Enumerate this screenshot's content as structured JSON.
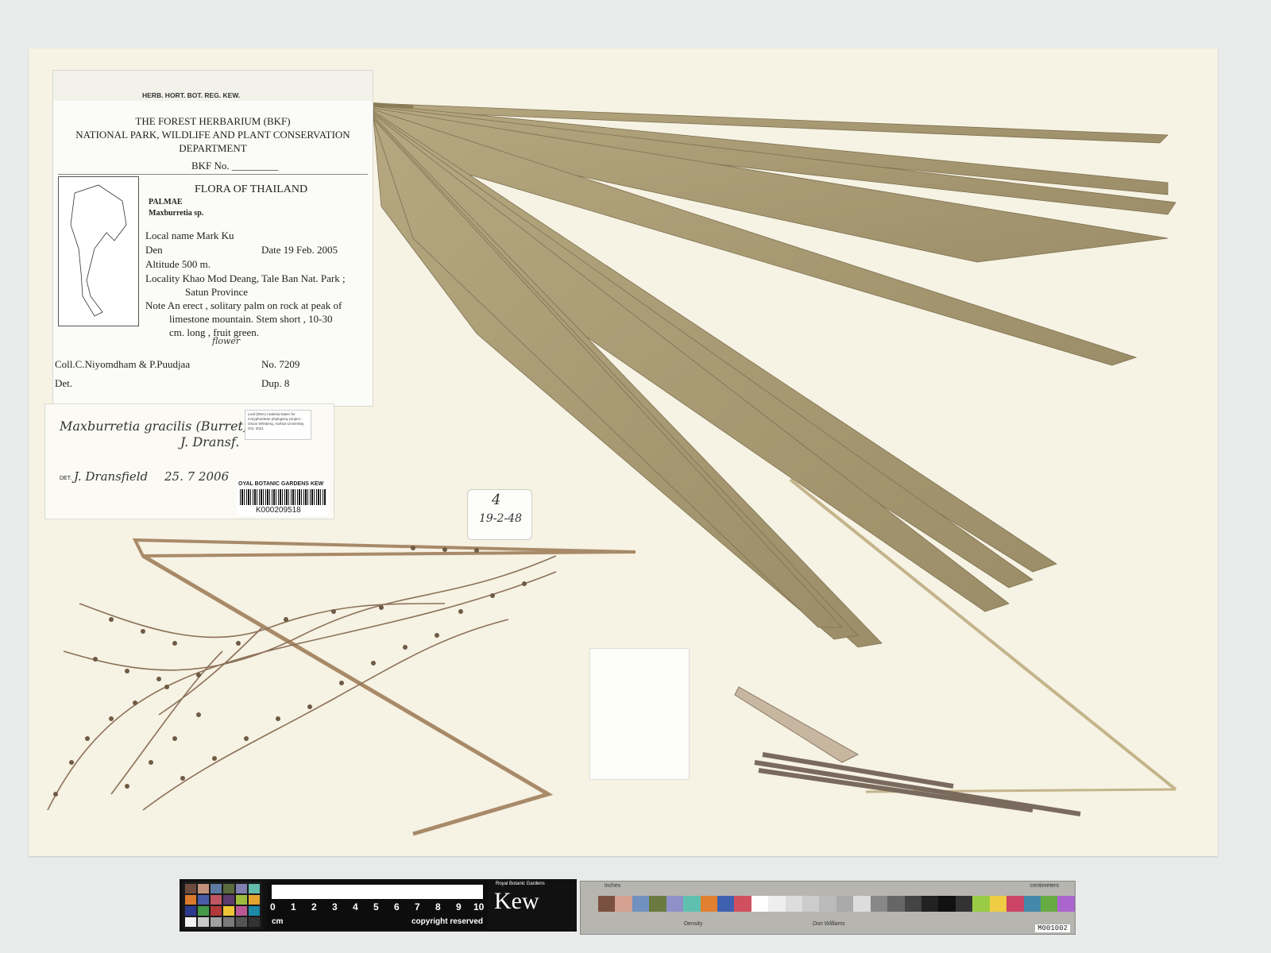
{
  "herbarium_header": "HERB. HORT. BOT. REG. KEW.",
  "institution": {
    "line1": "THE FOREST HERBARIUM (BKF)",
    "line2": "NATIONAL PARK, WILDLIFE AND PLANT CONSERVATION",
    "line3": "DEPARTMENT",
    "bkf_no": "BKF No. _________"
  },
  "flora": {
    "title": "FLORA OF THAILAND",
    "family": "PALMAE",
    "genus": "Maxburretia sp.",
    "local_name": "Local name Mark Ku",
    "den": "Den",
    "date": "Date  19 Feb. 2005",
    "altitude": "Altitude  500 m.",
    "locality1": "Locality Khao Mod Deang, Tale Ban Nat. Park ;",
    "locality2": "Satun Province",
    "note1": "Note  An erect , solitary palm on rock at peak of",
    "note2": "limestone mountain. Stem short , 10-30",
    "note3": "cm. long , fruit green.",
    "note_correction": "flower",
    "collector": "Coll.C.Niyomdham &  P.Puudjaa",
    "number": "No.  7209",
    "det": "Det.",
    "dup": "Dup.  8"
  },
  "determination": {
    "name": "Maxburretia gracilis (Burret)",
    "author": "J. Dransf.",
    "det_prefix": "DET.",
    "det_by": "J. Dransfield",
    "det_date": "25. 7  2006"
  },
  "dna_note": "Leaf (DNA) material taken for Coryphoideae phylogeny project - Oscar Wrisberg, Aarhus University, Oct. 2021",
  "barcode": {
    "header": "OYAL BOTANIC GARDENS KEW",
    "code": "K000209518"
  },
  "tag": {
    "number": "4",
    "date": "19-2-48"
  },
  "scale_bar": {
    "numbers": [
      "0",
      "1",
      "2",
      "3",
      "4",
      "5",
      "6",
      "7",
      "8",
      "9",
      "10"
    ],
    "unit": "cm",
    "copyright": "copyright reserved",
    "brand": "Kew",
    "brand_small": "Royal Botanic Gardens"
  },
  "calibration_card": {
    "inches": "inches",
    "centimeters": "centimeters",
    "density": "Density",
    "maker": "Don Williams",
    "code": "M001002"
  }
}
